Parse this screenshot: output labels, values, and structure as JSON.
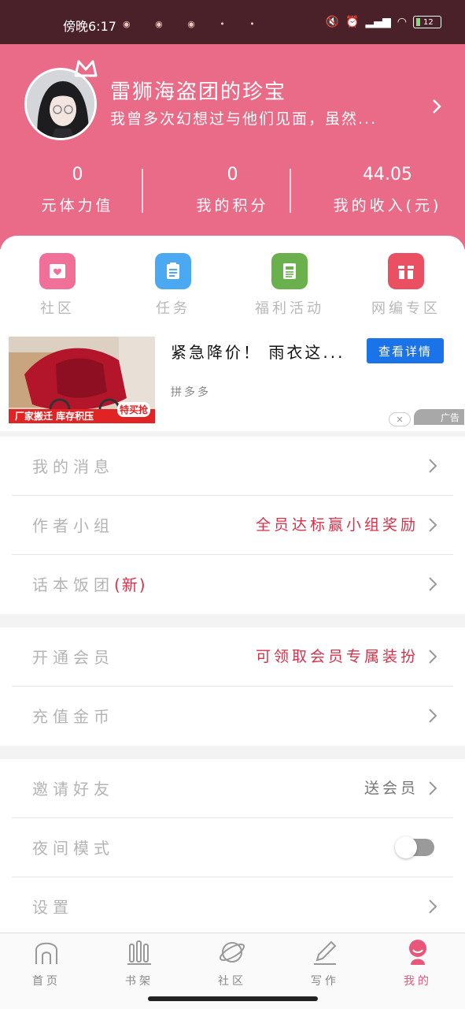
{
  "status_bar": {
    "time": "傍晚6:17",
    "notification_icons": "◉ ◉ ◉ • •",
    "battery": "12"
  },
  "profile": {
    "name": "雷狮海盗团的珍宝",
    "signature": "我曾多次幻想过与他们见面，虽然...",
    "stats": [
      {
        "value": "0",
        "label": "元体力值"
      },
      {
        "value": "0",
        "label": "我的积分"
      },
      {
        "value": "44.05",
        "label": "我的收入(元)"
      }
    ]
  },
  "quick_links": [
    {
      "label": "社区",
      "color": "#f0709a",
      "icon": "community-icon"
    },
    {
      "label": "任务",
      "color": "#4aa9f0",
      "icon": "task-icon"
    },
    {
      "label": "福利活动",
      "color": "#6ab04c",
      "icon": "welfare-icon"
    },
    {
      "label": "网编专区",
      "color": "#ea4f62",
      "icon": "gift-icon"
    }
  ],
  "ad": {
    "title": "紧急降价！ 雨衣这...",
    "button": "查看详情",
    "source": "拼多多",
    "image_caption": "厂家搬迁  库存积压",
    "image_tag": "特买抢",
    "close": "✕",
    "badge": "广告"
  },
  "menu_group_1": [
    {
      "label": "我的消息",
      "value": ""
    },
    {
      "label": "作者小组",
      "value": "全员达标赢小组奖励"
    },
    {
      "label": "话本饭团",
      "label_suffix": "(新)",
      "value": ""
    }
  ],
  "menu_group_2": [
    {
      "label": "开通会员",
      "value": "可领取会员专属装扮"
    },
    {
      "label": "充值金币",
      "value": ""
    }
  ],
  "menu_group_3": [
    {
      "label": "邀请好友",
      "value": "送会员"
    },
    {
      "label": "夜间模式",
      "toggle": false
    },
    {
      "label": "设置",
      "value": ""
    }
  ],
  "tabs": [
    {
      "label": "首页",
      "icon": "home-icon",
      "active": false
    },
    {
      "label": "书架",
      "icon": "bookshelf-icon",
      "active": false
    },
    {
      "label": "社区",
      "icon": "planet-icon",
      "active": false
    },
    {
      "label": "写作",
      "icon": "pencil-icon",
      "active": false
    },
    {
      "label": "我的",
      "icon": "profile-icon",
      "active": true
    }
  ],
  "colors": {
    "header": "#ea6b87",
    "status_bar": "#4a2129",
    "accent_red": "#d9304a",
    "active_tab": "#e8567a"
  }
}
